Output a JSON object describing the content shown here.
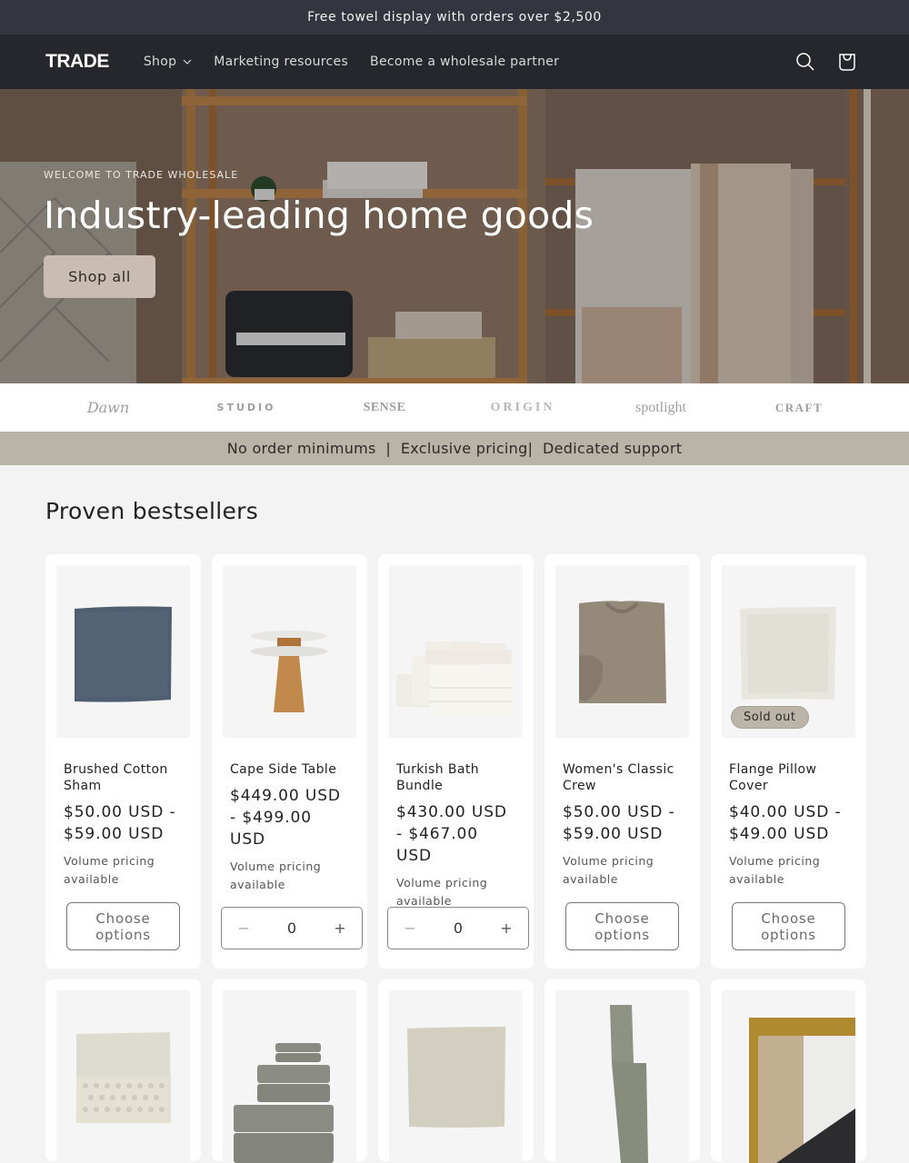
{
  "announcement": "Free towel display with orders over $2,500",
  "header": {
    "logo": "TRADE",
    "nav": [
      {
        "label": "Shop",
        "has_dropdown": true
      },
      {
        "label": "Marketing resources",
        "has_dropdown": false
      },
      {
        "label": "Become a wholesale partner",
        "has_dropdown": false
      }
    ],
    "icons": [
      "search-icon",
      "cart-icon"
    ]
  },
  "hero": {
    "eyebrow": "WELCOME TO TRADE WHOLESALE",
    "title": "Industry-leading home goods",
    "button": "Shop all"
  },
  "brands": [
    "Dawn",
    "STUDIO",
    "SENSE",
    "ORIGIN",
    "spotlight",
    "CRAFT"
  ],
  "usp": "No order minimums  |  Exclusive pricing|  Dedicated support",
  "section": {
    "title": "Proven bestsellers",
    "products": [
      {
        "title": "Brushed Cotton Sham",
        "price": "$50.00 USD - $59.00 USD",
        "note": "Volume pricing available",
        "action": "Choose options",
        "sold_out": false
      },
      {
        "title": "Cape Side Table",
        "price": "$449.00 USD - $499.00 USD",
        "note": "Volume pricing available",
        "action": "quantity",
        "quantity": "0",
        "sold_out": false
      },
      {
        "title": "Turkish Bath Bundle",
        "price": "$430.00 USD - $467.00 USD",
        "note": "Volume pricing available",
        "action": "quantity",
        "quantity": "0",
        "sold_out": false
      },
      {
        "title": "Women's Classic Crew",
        "price": "$50.00 USD - $59.00 USD",
        "note": "Volume pricing available",
        "action": "Choose options",
        "sold_out": false
      },
      {
        "title": "Flange Pillow Cover",
        "price": "$40.00 USD - $49.00 USD",
        "note": "Volume pricing available",
        "action": "Choose options",
        "sold_out": true,
        "badge": "Sold out"
      }
    ],
    "qty_minus": "−",
    "qty_plus": "+"
  },
  "colors": {
    "announcement_bg": "#33363f",
    "header_bg": "#25272c",
    "hero_button_bg": "#c9bcb3",
    "usp_bg": "#bab3a8",
    "page_bg": "#f3f3f3"
  }
}
